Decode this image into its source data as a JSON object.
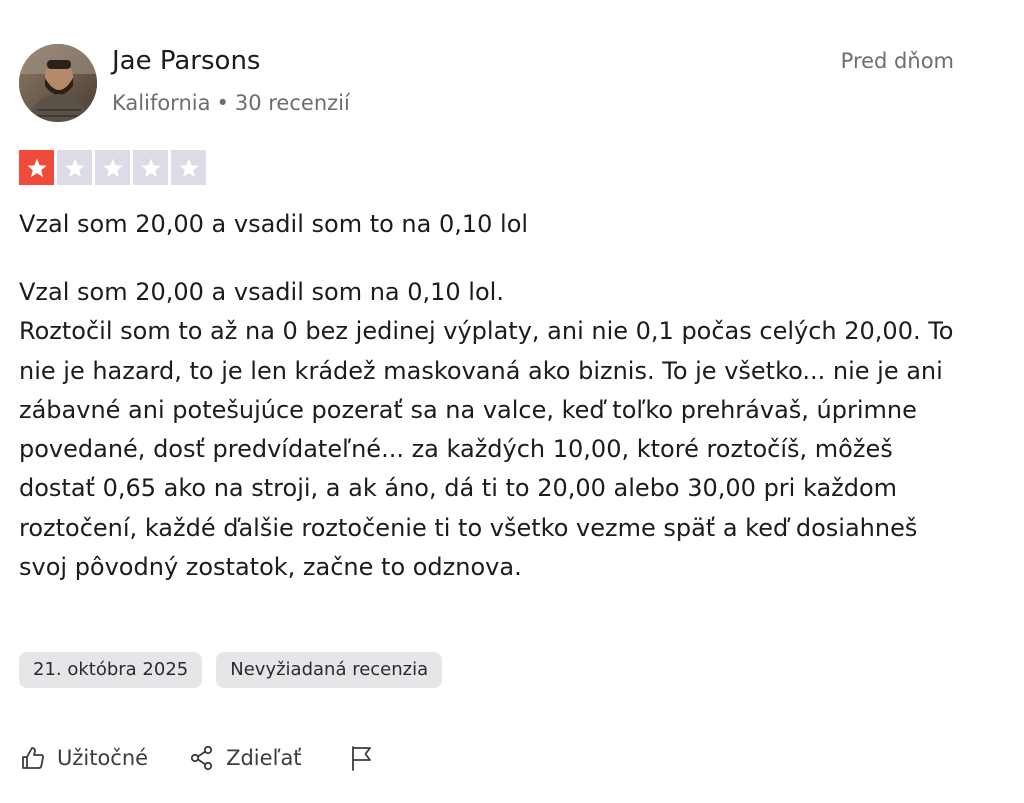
{
  "reviewer": {
    "name": "Jae Parsons",
    "location": "Kalifornia",
    "separator": "•",
    "review_count": "30 recenzií"
  },
  "relative_time": "Pred dňom",
  "rating": {
    "value": 1,
    "max": 5,
    "filled_color": "#ef4b38",
    "empty_color": "#dcdce6"
  },
  "review": {
    "title": "Vzal som 20,00 a vsadil som to na 0,10 lol",
    "body_lines": [
      "Vzal som 20,00 a vsadil som na 0,10 lol.",
      "Roztočil som to až na 0 bez jedinej výplaty, ani nie 0,1 počas celých 20,00. To nie je hazard, to je len krádež maskovaná ako biznis. To je všetko... nie je ani zábavné ani potešujúce pozerať sa na valce, keď toľko prehrávaš, úprimne povedané, dosť predvídateľné... za každých 10,00, ktoré roztočíš, môžeš dostať 0,65 ako na stroji, a ak áno, dá ti to 20,00 alebo 30,00 pri každom roztočení, každé ďalšie roztočenie ti to všetko vezme späť a keď dosiahneš svoj pôvodný zostatok, začne to odznova."
    ]
  },
  "tags": {
    "date": "21. októbra 2025",
    "type": "Nevyžiadaná recenzia"
  },
  "actions": {
    "helpful_label": "Užitočné",
    "share_label": "Zdieľať",
    "helpful_icon": "thumbs-up-icon",
    "share_icon": "share-icon",
    "report_icon": "flag-icon"
  }
}
